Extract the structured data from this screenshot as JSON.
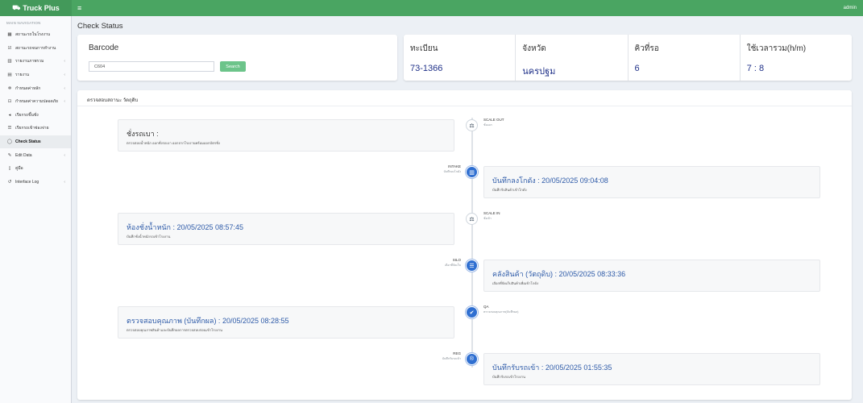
{
  "app": {
    "brand": "Truck Plus",
    "user": "admin"
  },
  "sidebar": {
    "header": "MAIN NAVIGATION",
    "items": [
      {
        "label": "สถานะรถในโรงงาน",
        "icon": "dashboard-icon",
        "glyph": "▦",
        "chev": false,
        "active": false
      },
      {
        "label": "สถานะรถจนการทำงาน",
        "icon": "checkbox-icon",
        "glyph": "☑",
        "chev": false,
        "active": false
      },
      {
        "label": "รายงานภาพรวม",
        "icon": "bar-chart-icon",
        "glyph": "▥",
        "chev": true,
        "active": false
      },
      {
        "label": "รายงาน",
        "icon": "book-icon",
        "glyph": "▤",
        "chev": true,
        "active": false
      },
      {
        "label": "กำหนดค่าหลัก",
        "icon": "gear-icon",
        "glyph": "✲",
        "chev": true,
        "active": false
      },
      {
        "label": "กำหนดค่าความปลอดภัย",
        "icon": "lock-icon",
        "glyph": "⊡",
        "chev": true,
        "active": false
      },
      {
        "label": "เรียกรถขึ้นชั่ง",
        "icon": "speaker-icon",
        "glyph": "◂",
        "chev": false,
        "active": false
      },
      {
        "label": "เรียกรถเข้าช่องจ่าย",
        "icon": "list-icon",
        "glyph": "☰",
        "chev": false,
        "active": false
      },
      {
        "label": "Check Status",
        "icon": "circle-check-icon",
        "glyph": "◯",
        "chev": false,
        "active": true
      },
      {
        "label": "Edit Data",
        "icon": "edit-icon",
        "glyph": "✎",
        "chev": true,
        "active": false
      },
      {
        "label": "คู่มือ",
        "icon": "manual-icon",
        "glyph": "▯",
        "chev": false,
        "active": false
      },
      {
        "label": "Interface Log",
        "icon": "history-icon",
        "glyph": "↺",
        "chev": true,
        "active": false
      }
    ]
  },
  "page": {
    "title": "Check Status"
  },
  "barcode": {
    "title": "Barcode",
    "value": "C604",
    "button": "Search"
  },
  "info": [
    {
      "label": "ทะเบียน",
      "value": "73-1366"
    },
    {
      "label": "จังหวัด",
      "value": "นครปฐม"
    },
    {
      "label": "คิวที่รอ",
      "value": "6"
    },
    {
      "label": "ใช้เวลารวม(h/m)",
      "value": "7 : 8"
    }
  ],
  "status": {
    "title": "ตรวจสอบสถานะ วัตถุดิบ",
    "timeline": [
      {
        "tag": "SCALE OUT",
        "tag_sub": "ชั่งออก",
        "icon": "scale-icon",
        "glyph": "⚖",
        "icon_style": "dark",
        "card_title": "ชั่งรถเบา :",
        "card_desc": "ตรวจสอบน้ำหนัก ออกชั่งรถเบา ออกจากโรงงานพร้อมออกบัตรชั่ง",
        "plain": true
      },
      {
        "tag": "INTAKE",
        "tag_sub": "บันทึกลงโกดัง",
        "icon": "warehouse-icon",
        "glyph": "▥",
        "icon_style": "blue",
        "card_title": "บันทึกลงโกดัง : 20/05/2025 09:04:08",
        "card_desc": "บันทึกรับสินค้าเข้าโกดัง",
        "plain": false
      },
      {
        "tag": "SCALE IN",
        "tag_sub": "ชั่งเข้า",
        "icon": "scale-icon",
        "glyph": "⚖",
        "icon_style": "dark",
        "card_title": "ห้องชั่งน้ำหนัก : 20/05/2025 08:57:45",
        "card_desc": "บันทึกชั่งน้ำหนักรถเข้าโรงงาน",
        "plain": false
      },
      {
        "tag": "SILO",
        "tag_sub": "เลือกที่จัดเก็บ",
        "icon": "database-icon",
        "glyph": "☰",
        "icon_style": "blue",
        "card_title": "คลังสินค้า (วัตถุดิบ) : 20/05/2025 08:33:36",
        "card_desc": "เลือกที่จัดเก็บสินค้าเพื่อเข้าโกดัง",
        "plain": false
      },
      {
        "tag": "QA",
        "tag_sub": "ตรวจสอบคุณภาพ(บันทึกผล)",
        "icon": "check-icon",
        "glyph": "✔",
        "icon_style": "blue",
        "card_title": "ตรวจสอบคุณภาพ (บันทึกผล) : 20/05/2025 08:28:55",
        "card_desc": "ตรวจสอบคุณภาพสินค้าและบันทึกผลการตรวจสอบก่อนเข้าโรงงาน",
        "plain": false
      },
      {
        "tag": "REG",
        "tag_sub": "บันทึกรับรถเข้า",
        "icon": "registration-icon",
        "glyph": "®",
        "icon_style": "blue",
        "card_title": "บันทึกรับรถเข้า : 20/05/2025 01:55:35",
        "card_desc": "บันทึกรับรถเข้าโรงงาน",
        "plain": false
      }
    ]
  }
}
